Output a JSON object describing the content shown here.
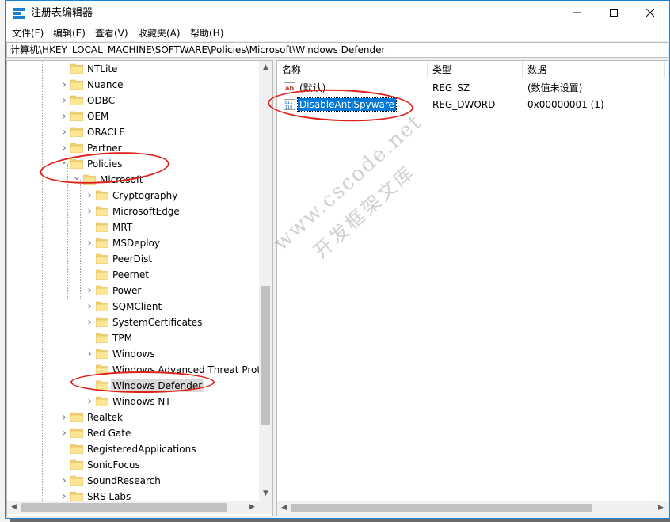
{
  "window": {
    "title": "注册表编辑器",
    "controls": {
      "minimize": "—",
      "maximize": "☐",
      "close": "✕"
    }
  },
  "menu": [
    "文件(F)",
    "编辑(E)",
    "查看(V)",
    "收藏夹(A)",
    "帮助(H)"
  ],
  "address": "计算机\\HKEY_LOCAL_MACHINE\\SOFTWARE\\Policies\\Microsoft\\Windows Defender",
  "tree": {
    "items": [
      {
        "label": "NTLite",
        "expander": ""
      },
      {
        "label": "Nuance",
        "expander": ">"
      },
      {
        "label": "ODBC",
        "expander": ">"
      },
      {
        "label": "OEM",
        "expander": ">"
      },
      {
        "label": "ORACLE",
        "expander": ">"
      },
      {
        "label": "Partner",
        "expander": ">"
      },
      {
        "label": "Policies",
        "expander": "v"
      },
      {
        "label": "Microsoft",
        "expander": "v"
      },
      {
        "label": "Cryptography",
        "expander": ">"
      },
      {
        "label": "MicrosoftEdge",
        "expander": ">"
      },
      {
        "label": "MRT",
        "expander": ""
      },
      {
        "label": "MSDeploy",
        "expander": ">"
      },
      {
        "label": "PeerDist",
        "expander": ""
      },
      {
        "label": "Peernet",
        "expander": ""
      },
      {
        "label": "Power",
        "expander": ">"
      },
      {
        "label": "SQMClient",
        "expander": ">"
      },
      {
        "label": "SystemCertificates",
        "expander": ">"
      },
      {
        "label": "TPM",
        "expander": ""
      },
      {
        "label": "Windows",
        "expander": ">"
      },
      {
        "label": "Windows Advanced Threat Protec",
        "expander": ""
      },
      {
        "label": "Windows Defender",
        "expander": "",
        "selected": true
      },
      {
        "label": "Windows NT",
        "expander": ">"
      },
      {
        "label": "Realtek",
        "expander": ">"
      },
      {
        "label": "Red Gate",
        "expander": ">"
      },
      {
        "label": "RegisteredApplications",
        "expander": ""
      },
      {
        "label": "SonicFocus",
        "expander": ""
      },
      {
        "label": "SoundResearch",
        "expander": ">"
      },
      {
        "label": "SRS Labs",
        "expander": ">"
      }
    ]
  },
  "list": {
    "headers": [
      "名称",
      "类型",
      "数据"
    ],
    "rows": [
      {
        "name": "(默认)",
        "type": "REG_SZ",
        "data": "(数值未设置)",
        "icon": "string-value-icon"
      },
      {
        "name": "DisableAntiSpyware",
        "type": "REG_DWORD",
        "data": "0x00000001 (1)",
        "icon": "binary-value-icon",
        "selected": true
      }
    ]
  },
  "watermark": {
    "line1": "www.cscode.net",
    "line2": "开发框架文库"
  },
  "colors": {
    "selection": "#0078d7",
    "annotation": "#e0201a",
    "folder": "#f4d67a"
  }
}
